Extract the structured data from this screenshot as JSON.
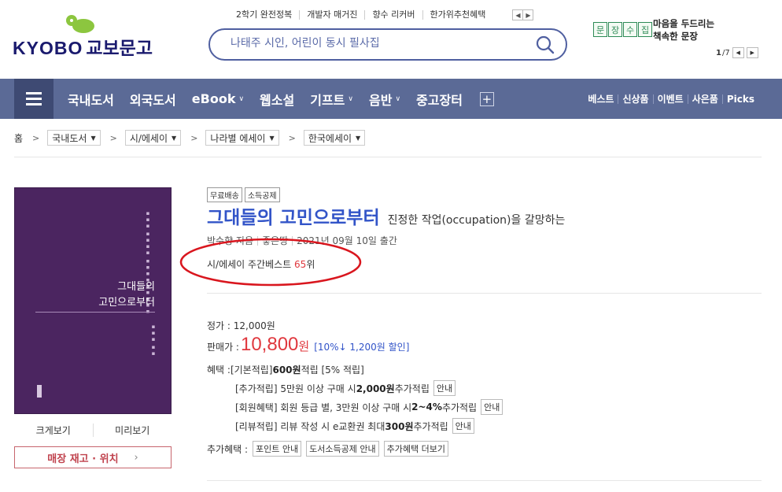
{
  "header": {
    "logo_text": "KYOBO",
    "logo_korean": "교보문고",
    "quick_links": [
      "2학기 완전정복",
      "개발자 매거진",
      "향수 리커버",
      "한가위추천혜택"
    ],
    "search": {
      "placeholder": "나태주 시인, 어린이 동시 필사집"
    },
    "promo": {
      "stamp": [
        "문",
        "장",
        "수",
        "집"
      ],
      "line1": "마음을 두드리는",
      "line2": "책속한 문장",
      "page_current": "1",
      "page_total": "/7"
    }
  },
  "nav": {
    "items": [
      "국내도서",
      "외국도서",
      "eBook",
      "웹소설",
      "기프트",
      "음반",
      "중고장터"
    ],
    "right": [
      "베스트",
      "신상품",
      "이벤트",
      "사은품",
      "Picks"
    ]
  },
  "breadcrumb": {
    "home": "홈",
    "levels": [
      "국내도서",
      "시/에세이",
      "나라별 에세이",
      "한국에세이"
    ]
  },
  "cover": {
    "title_line1": "그대들의",
    "title_line2": "고민으로부터",
    "links": [
      "크게보기",
      "미리보기"
    ],
    "stock_button": "매장 재고 · 위치"
  },
  "book": {
    "badges": [
      "무료배송",
      "소득공제"
    ],
    "title": "그대들의 고민으로부터",
    "subtitle": "진정한 작업(occupation)을 갈망하는",
    "author": "박수향 지음",
    "publisher": "좋은땅",
    "date": "2021년 09월 10일 출간",
    "rank_prefix": "시/에세이 주간베스트 ",
    "rank_num": "65",
    "rank_suffix": "위"
  },
  "price": {
    "list": "정가 : 12,000원",
    "sale_label": "판매가 : ",
    "sale_value": "10,800",
    "sale_unit": "원",
    "discount": "[10%↓ 1,200원 할인]"
  },
  "benefits": {
    "label": "혜택 : ",
    "basic_a": "[기본적립] ",
    "basic_b": "600원",
    "basic_c": " 적립 [5% 적립]",
    "extra_a": "[추가적립] 5만원 이상 구매 시 ",
    "extra_b": "2,000원",
    "extra_c": " 추가적립",
    "member_a": "[회원혜택] 회원 등급 별, 3만원 이상 구매 시 ",
    "member_b": "2~4%",
    "member_c": " 추가적립",
    "review_a": "[리뷰적립] 리뷰 작성 시 e교환권 최대 ",
    "review_b": "300원",
    "review_c": " 추가적립",
    "info_button": "안내"
  },
  "extra": {
    "label": "추가혜택 : ",
    "buttons": [
      "포인트 안내",
      "도서소득공제 안내",
      "추가혜택 더보기"
    ]
  },
  "colors": {
    "nav": "#5b6a96",
    "title": "#3254c8",
    "price": "#e0383e",
    "annotation": "#d9161e"
  }
}
